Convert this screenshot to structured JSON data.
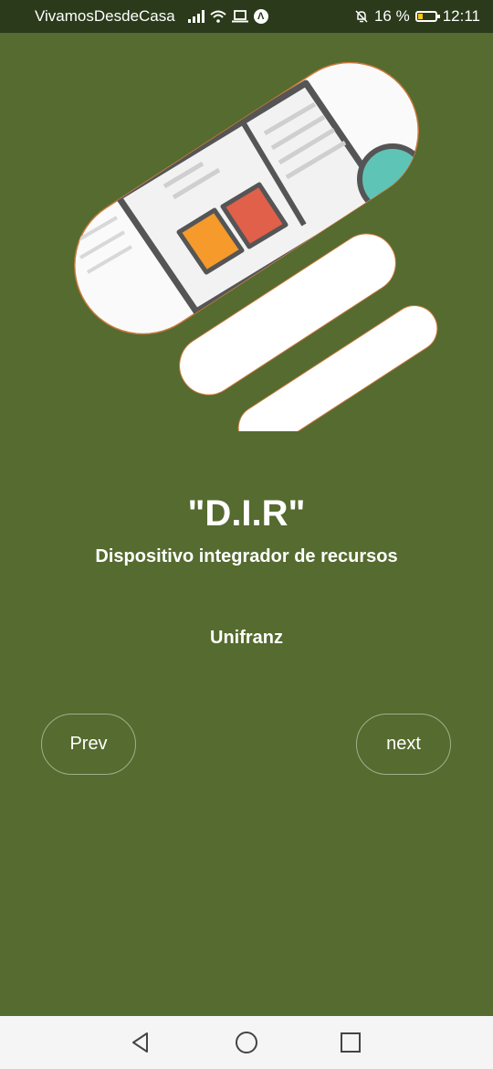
{
  "status_bar": {
    "carrier": "VivamosDesdeCasa",
    "battery_percent": "16 %",
    "time": "12:11",
    "icons": [
      "signal-icon",
      "wifi-icon",
      "laptop-icon",
      "app-a-icon",
      "mute-icon",
      "battery-icon"
    ]
  },
  "app": {
    "title": "\"D.I.R\"",
    "subtitle": "Dispositivo integrador de recursos",
    "organization": "Unifranz",
    "prev_label": "Prev",
    "next_label": "next"
  },
  "colors": {
    "background": "#556b2f",
    "status_bar": "#2a3a1a",
    "text": "#ffffff",
    "nav_bar": "#f5f5f5",
    "accent_orange": "#f59a2b",
    "accent_red": "#e0604a",
    "accent_teal": "#5ec4b6"
  },
  "nav_bar": {
    "icons": [
      "back-icon",
      "home-icon",
      "recents-icon"
    ]
  }
}
